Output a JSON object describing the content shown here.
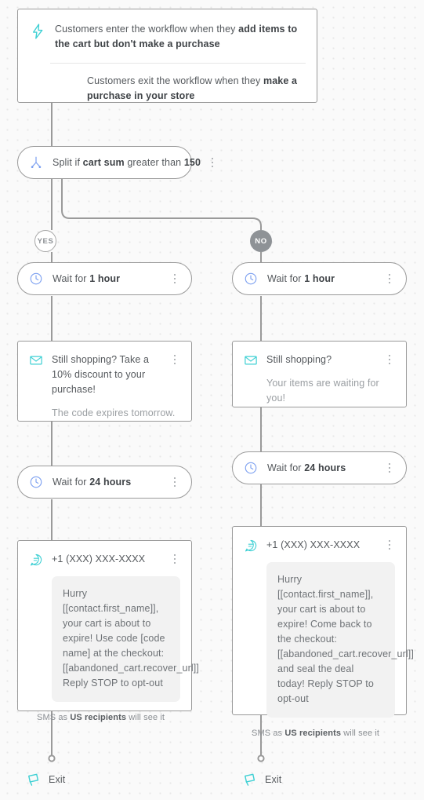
{
  "theme": {
    "accent_teal": "#3fd0d4",
    "accent_blue": "#7b9ff0",
    "connector_gray": "#9a9a9a",
    "text_gray": "#54585c",
    "muted_gray": "#9a9ea2",
    "canvas_bg": "#fafafa"
  },
  "trigger": {
    "icon": "lightning-bolt-icon",
    "entry_prefix": "Customers enter the workflow when they ",
    "entry_bold": "add items to the cart but don't make a purchase",
    "exit_prefix": "Customers exit the workflow when they ",
    "exit_bold": "make a purchase in your store"
  },
  "split": {
    "icon": "split-branch-icon",
    "prefix": "Split if ",
    "bold_field": "cart sum",
    "middle": " greater than ",
    "bold_value": "150",
    "menu": "kebab-menu-icon"
  },
  "branches": {
    "yes_label": "YES",
    "no_label": "NO"
  },
  "yes_branch": {
    "wait_1": {
      "icon": "clock-icon",
      "prefix": "Wait for ",
      "bold": "1 hour"
    },
    "email": {
      "icon": "envelope-icon",
      "subject": "Still shopping? Take a 10% discount to your purchase!",
      "preview": "The code expires tomorrow."
    },
    "wait_2": {
      "icon": "clock-icon",
      "prefix": "Wait for ",
      "bold": "24 hours"
    },
    "sms": {
      "icon": "sms-chat-icon",
      "sender": "+1 (XXX) XXX-XXXX",
      "body": "Hurry [[contact.first_name]], your cart is about to expire! Use code [code name] at the checkout: [[abandoned_cart.recover_url]] Reply STOP to opt-out",
      "footer_prefix": "SMS as ",
      "footer_bold": "US recipients",
      "footer_suffix": " will see it"
    },
    "exit": {
      "icon": "exit-flag-icon",
      "label": "Exit"
    }
  },
  "no_branch": {
    "wait_1": {
      "icon": "clock-icon",
      "prefix": "Wait for ",
      "bold": "1 hour"
    },
    "email": {
      "icon": "envelope-icon",
      "subject": "Still shopping?",
      "preview": "Your items are waiting for you!"
    },
    "wait_2": {
      "icon": "clock-icon",
      "prefix": "Wait for ",
      "bold": "24 hours"
    },
    "sms": {
      "icon": "sms-chat-icon",
      "sender": "+1 (XXX) XXX-XXXX",
      "body": "Hurry [[contact.first_name]], your cart is about to expire! Come back to the checkout: [[abandoned_cart.recover_url]] and seal the deal today! Reply STOP to opt-out",
      "footer_prefix": "SMS as ",
      "footer_bold": "US recipients",
      "footer_suffix": " will see it"
    },
    "exit": {
      "icon": "exit-flag-icon",
      "label": "Exit"
    }
  }
}
